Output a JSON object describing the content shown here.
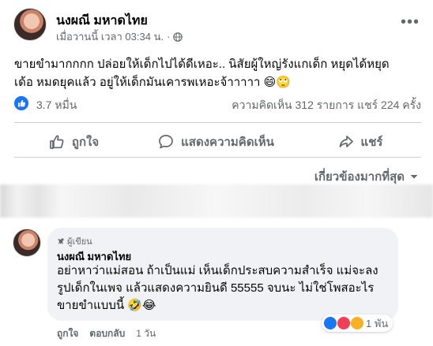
{
  "post": {
    "author": "นงผณี มหาดไทย",
    "timestamp": "เมื่อวานนี้ เวลา 03:34 น.",
    "separator": "·",
    "more_label": "•••",
    "text_line1": "ขายขำมากกกก ปล่อยให้เด็กไปได้ดีเหอะ.. นิสัยผู้ใหญ่รังแกเด็ก หยุดได้หยุด",
    "text_line2": "เด้อ หมดยุคแล้ว อยู่ให้เด็กมันเคารพเหอะจ้าาาาา 😄🙄",
    "likes": "3.7 หมื่น",
    "comments_shares": "ความคิดเห็น 312 รายการ  แชร์ 224 ครั้ง"
  },
  "actions": {
    "like": "ถูกใจ",
    "comment": "แสดงความคิดเห็น",
    "share": "แชร์"
  },
  "filter": {
    "label": "เกี่ยวข้องมากที่สุด"
  },
  "comment": {
    "badge": "ผู้เขียน",
    "author": "นงผณี มหาดไทย",
    "line1": "อย่าหาว่าแม่สอน ถ้าเป็นแม่ เห็นเด็กประสบความสำเร็จ แม่จะลง",
    "line2": "รูปเด็กในเพจ แล้วแสดงความยินดี 55555 จบนะ ไม่ใช่โพสอะไร",
    "line3": "ขายขำแบบนี้ 🤣😂",
    "reaction_count": "1 พัน",
    "like_action": "ถูกใจ",
    "reply_action": "ตอบกลับ",
    "age": "1 วัน"
  },
  "colors": {
    "facebook_blue": "#1877f2",
    "secondary_text": "#65676b",
    "bubble_bg": "#f0f2f5",
    "love_red": "#f33e58",
    "haha_yellow": "#f7b125"
  },
  "icons": [
    "globe-icon",
    "more-icon",
    "like-reaction-icon",
    "thumb-up-icon",
    "comment-icon",
    "share-icon",
    "chevron-down-icon",
    "author-badge-icon"
  ]
}
